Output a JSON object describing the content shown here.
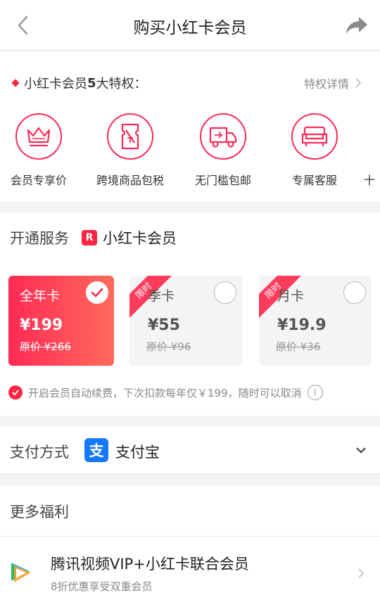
{
  "header": {
    "title": "购买小红卡会员"
  },
  "privileges": {
    "title_prefix": "小红卡会员",
    "title_count": "5",
    "title_suffix": "大特权：",
    "detail_label": "特权详情",
    "items": [
      {
        "label": "会员专享价",
        "icon": "crown-icon"
      },
      {
        "label": "跨境商品包税",
        "icon": "tax-free-ticket-icon"
      },
      {
        "label": "无门槛包邮",
        "icon": "delivery-truck-icon"
      },
      {
        "label": "专属客服",
        "icon": "service-sofa-icon"
      },
      {
        "label": "十",
        "icon": "more-icon"
      }
    ]
  },
  "service": {
    "title": "开通服务",
    "logo_letter": "R",
    "brand": "小红卡会员",
    "plans": [
      {
        "name": "全年卡",
        "price": "¥199",
        "original": "原价 ¥266",
        "selected": true,
        "badge": ""
      },
      {
        "name": "季卡",
        "price": "¥55",
        "original": "原价 ¥96",
        "selected": false,
        "badge": "限时"
      },
      {
        "name": "月卡",
        "price": "¥19.9",
        "original": "原价 ¥36",
        "selected": false,
        "badge": "限时"
      }
    ],
    "renew_text": "开启会员自动续费，下次扣款每年仅￥199，随时可以取消",
    "renew_checked": true,
    "info_glyph": "i"
  },
  "payment": {
    "label": "支付方式",
    "icon_glyph": "支",
    "method": "支付宝"
  },
  "more": {
    "title": "更多福利",
    "offer_title": "腾讯视频VIP+小红卡联合会员",
    "offer_subtitle": "8折优惠享受双重会员"
  },
  "colors": {
    "accent": "#ff2442",
    "alipay": "#1677ff"
  }
}
